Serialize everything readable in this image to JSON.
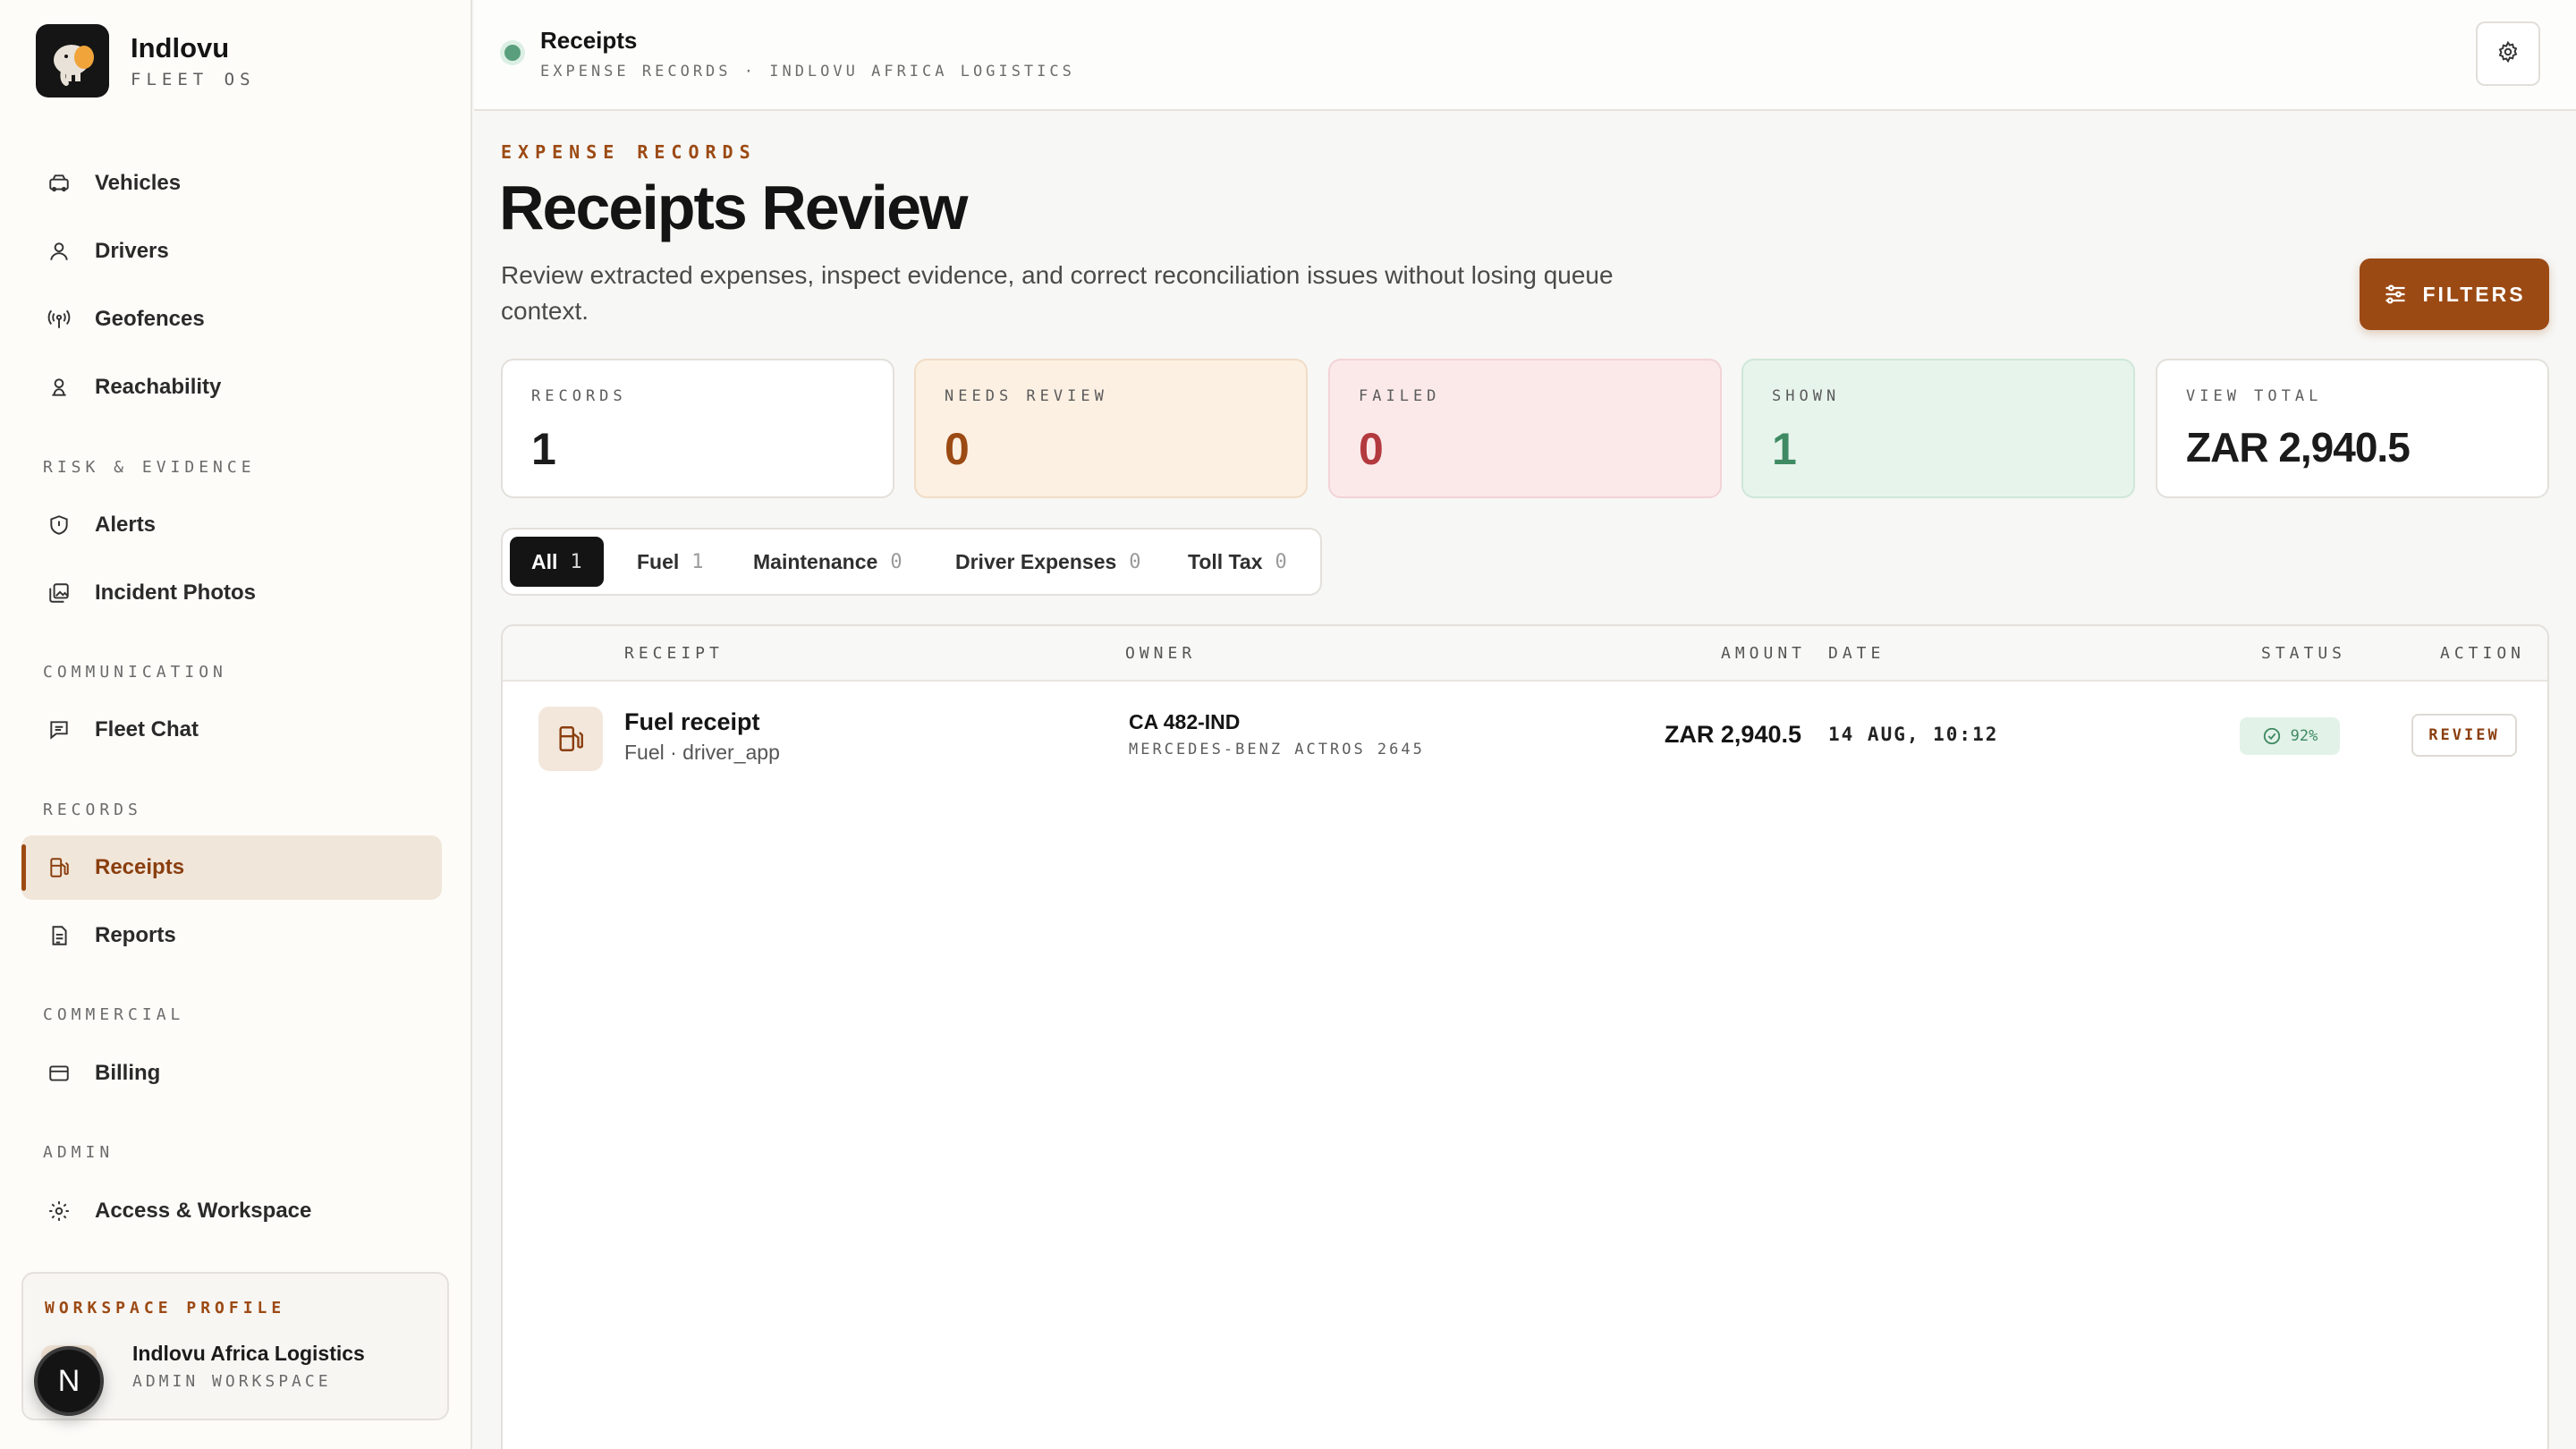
{
  "brand": {
    "name": "Indlovu",
    "subtitle": "FLEET OS"
  },
  "nav": {
    "vehicles": "Vehicles",
    "drivers": "Drivers",
    "geofences": "Geofences",
    "reachability": "Reachability",
    "section_risk": "RISK & EVIDENCE",
    "alerts": "Alerts",
    "incident_photos": "Incident Photos",
    "section_communication": "COMMUNICATION",
    "fleet_chat": "Fleet Chat",
    "section_records": "RECORDS",
    "receipts": "Receipts",
    "reports": "Reports",
    "section_commercial": "COMMERCIAL",
    "billing": "Billing",
    "section_admin": "ADMIN",
    "access_workspace": "Access & Workspace"
  },
  "workspace": {
    "label": "WORKSPACE PROFILE",
    "name": "Indlovu Africa Logistics",
    "role": "ADMIN WORKSPACE",
    "avatar_letter": "N"
  },
  "header": {
    "title": "Receipts",
    "subtitle": "EXPENSE RECORDS · INDLOVU AFRICA LOGISTICS"
  },
  "page": {
    "eyebrow": "EXPENSE RECORDS",
    "title": "Receipts Review",
    "description": "Review extracted expenses, inspect evidence, and correct reconciliation issues without losing queue context.",
    "filters_label": "FILTERS"
  },
  "stats": {
    "records": {
      "label": "RECORDS",
      "value": "1"
    },
    "needs_review": {
      "label": "NEEDS REVIEW",
      "value": "0"
    },
    "failed": {
      "label": "FAILED",
      "value": "0"
    },
    "shown": {
      "label": "SHOWN",
      "value": "1"
    },
    "view_total": {
      "label": "VIEW TOTAL",
      "value": "ZAR 2,940.5"
    }
  },
  "tabs": [
    {
      "label": "All",
      "count": "1"
    },
    {
      "label": "Fuel",
      "count": "1"
    },
    {
      "label": "Maintenance",
      "count": "0"
    },
    {
      "label": "Driver Expenses",
      "count": "0"
    },
    {
      "label": "Toll Tax",
      "count": "0"
    }
  ],
  "table": {
    "columns": {
      "receipt": "RECEIPT",
      "owner": "OWNER",
      "amount": "AMOUNT",
      "date": "DATE",
      "status": "STATUS",
      "action": "ACTION"
    },
    "rows": [
      {
        "title": "Fuel receipt",
        "subtitle": "Fuel · driver_app",
        "plate": "CA 482-IND",
        "vehicle": "MERCEDES-BENZ ACTROS 2645",
        "amount": "ZAR 2,940.5",
        "date": "14 AUG, 10:12",
        "status": "92%",
        "action": "REVIEW"
      }
    ]
  },
  "colors": {
    "accent": "#9c4a14",
    "active_bg": "#f1e6da",
    "success": "#3f8a62",
    "danger": "#b23a3f",
    "status_dot": "#5a9f7d"
  },
  "icons": {
    "vehicles": "car-icon",
    "drivers": "user-icon",
    "geofences": "broadcast-icon",
    "reachability": "person-pin-icon",
    "alerts": "shield-icon",
    "incident_photos": "photos-icon",
    "fleet_chat": "chat-icon",
    "receipts": "fuel-pump-icon",
    "reports": "document-icon",
    "billing": "credit-card-icon",
    "access_workspace": "gear-icon",
    "settings": "gear-icon",
    "filters": "sliders-icon",
    "status": "check-circle-icon"
  }
}
